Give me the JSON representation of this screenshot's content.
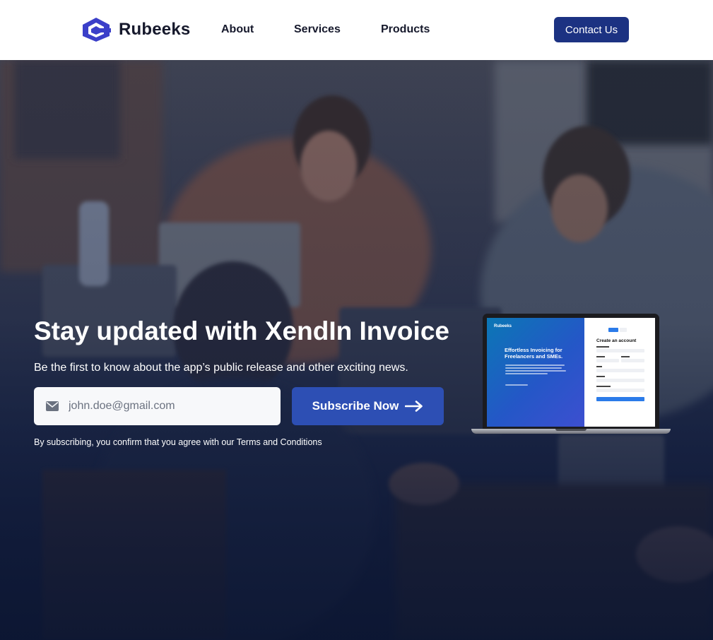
{
  "header": {
    "brand": "Rubeeks",
    "nav": [
      {
        "label": "About"
      },
      {
        "label": "Services"
      },
      {
        "label": "Products"
      }
    ],
    "contact_label": "Contact Us",
    "logo_icon": "rubeeks-hexagon-logo",
    "accent_color": "#1c3282"
  },
  "hero": {
    "title": "Stay updated with XendIn Invoice",
    "subtitle": "Be the first to know about the app’s public release and other exciting news.",
    "email_placeholder": "john.doe@gmail.com",
    "email_icon": "mail-icon",
    "subscribe_label": "Subscribe Now",
    "subscribe_icon": "arrow-right-icon",
    "terms": "By subscribing, you confirm that you agree with our Terms and Conditions",
    "button_color": "#2d4fb4"
  },
  "mockup": {
    "brand": "Rubeeks",
    "headline": "Effortless Invoicing for Freelancers and SMEs.",
    "form_title": "Create an account"
  }
}
